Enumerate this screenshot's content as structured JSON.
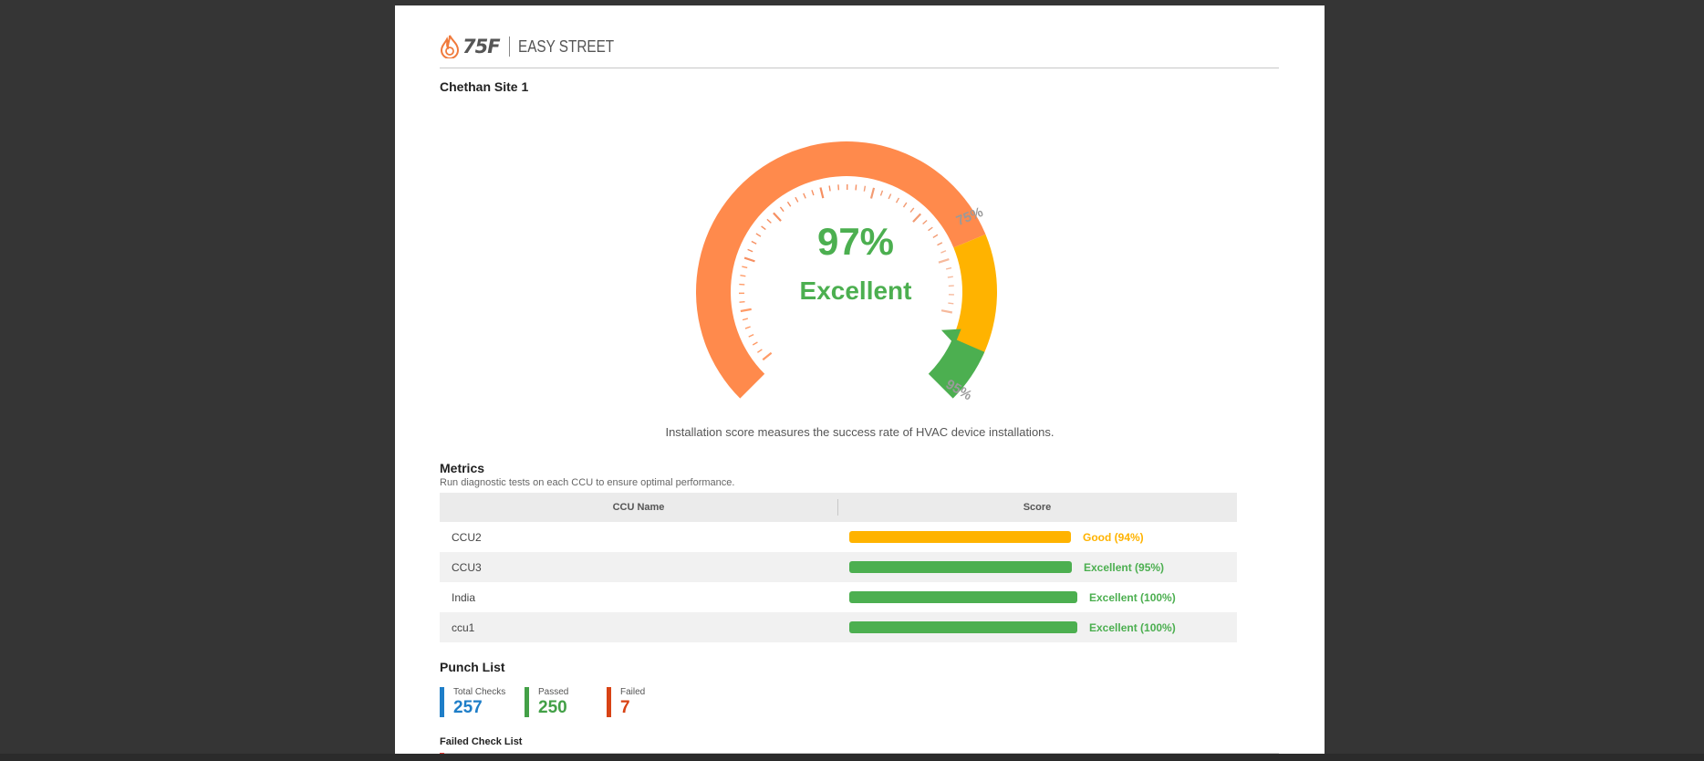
{
  "header": {
    "logo_text": "75F",
    "brand_name": "EASY STREET"
  },
  "site": {
    "title": "Chethan Site 1"
  },
  "gauge": {
    "score_percent": 97,
    "score_text": "97%",
    "status": "Excellent",
    "threshold_75_label": "75%",
    "threshold_95_label": "95%",
    "colors": {
      "poor": "#ff8a4c",
      "good": "#ffb300",
      "excellent": "#4caf50"
    }
  },
  "caption": "Installation score measures the success rate of HVAC device installations.",
  "metrics": {
    "title": "Metrics",
    "subtitle": "Run diagnostic tests on each CCU to ensure optimal performance.",
    "columns": {
      "name": "CCU Name",
      "score": "Score"
    },
    "rows": [
      {
        "name": "CCU2",
        "score": 94,
        "label": "Good (94%)",
        "color": "#ffb300"
      },
      {
        "name": "CCU3",
        "score": 95,
        "label": "Excellent (95%)",
        "color": "#4caf50"
      },
      {
        "name": "India",
        "score": 100,
        "label": "Excellent (100%)",
        "color": "#4caf50"
      },
      {
        "name": "ccu1",
        "score": 100,
        "label": "Excellent (100%)",
        "color": "#4caf50"
      }
    ]
  },
  "punch_list": {
    "title": "Punch List",
    "stats": [
      {
        "label": "Total Checks",
        "value": "257",
        "color": "#1e7ec8"
      },
      {
        "label": "Passed",
        "value": "250",
        "color": "#43a047"
      },
      {
        "label": "Failed",
        "value": "7",
        "color": "#d84315"
      }
    ]
  },
  "failed_check_list": {
    "title": "Failed Check List"
  }
}
